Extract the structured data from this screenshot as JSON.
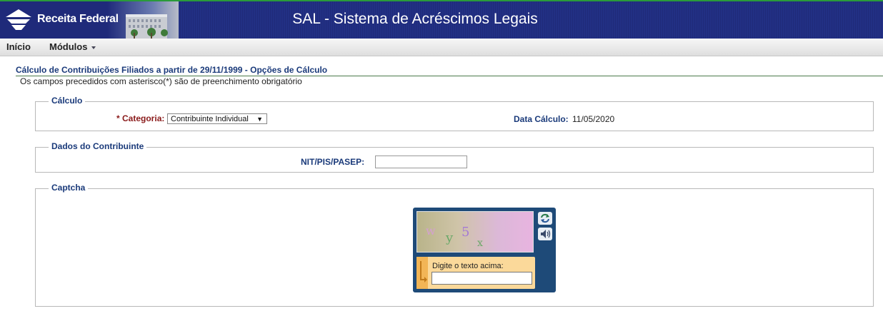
{
  "header": {
    "brand": "Receita Federal",
    "title": "SAL - Sistema de Acréscimos Legais"
  },
  "menu": {
    "items": [
      {
        "label": "Início"
      },
      {
        "label": "Módulos"
      }
    ]
  },
  "page": {
    "title": "Cálculo de Contribuições Filiados a partir de 29/11/1999 - Opções de Cálculo",
    "subtitle": "Os campos precedidos com asterisco(*) são de preenchimento obrigatório"
  },
  "calculo": {
    "legend": "Cálculo",
    "categoria_label": "Categoria:",
    "categoria_required": "* ",
    "categoria_value": "Contribuinte Individual",
    "data_label": "Data Cálculo:",
    "data_value": "11/05/2020"
  },
  "contribuinte": {
    "legend": "Dados do Contribuinte",
    "nit_label": "NIT/PIS/PASEP:",
    "nit_value": ""
  },
  "captcha": {
    "legend": "Captcha",
    "prompt": "Digite o texto acima:",
    "value": "",
    "chars": [
      "w",
      "y",
      "5",
      "x"
    ]
  },
  "colors": {
    "header_bg": "#1f2a7a",
    "label_blue": "#1a3a7a",
    "required_red": "#8a1a1a",
    "captcha_bg": "#1e4a78"
  }
}
